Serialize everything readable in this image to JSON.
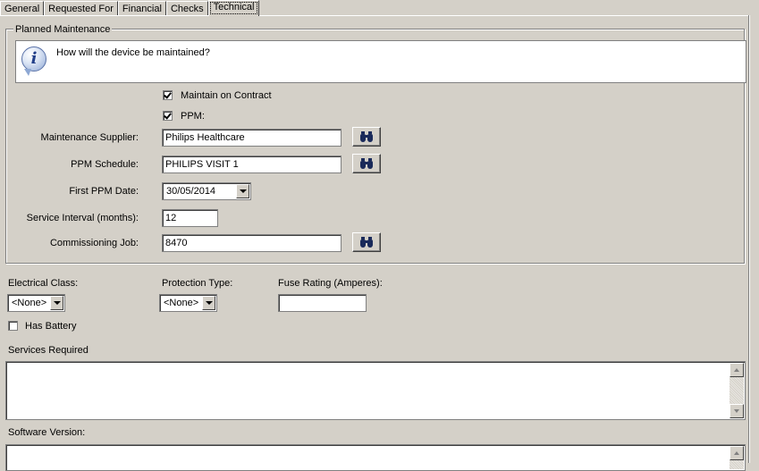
{
  "tabs": [
    {
      "label": "General"
    },
    {
      "label": "Requested For"
    },
    {
      "label": "Financial"
    },
    {
      "label": "Checks"
    },
    {
      "label": "Technical",
      "active": true
    }
  ],
  "planned_maintenance": {
    "title": "Planned Maintenance",
    "info_text": "How will the device be maintained?",
    "maintain_on_contract": {
      "label": "Maintain on Contract",
      "checked": true
    },
    "ppm": {
      "label": "PPM:",
      "checked": true
    },
    "maintenance_supplier": {
      "label": "Maintenance Supplier:",
      "value": "Philips Healthcare"
    },
    "ppm_schedule": {
      "label": "PPM Schedule:",
      "value": "PHILIPS VISIT 1"
    },
    "first_ppm_date": {
      "label": "First PPM Date:",
      "value": "30/05/2014"
    },
    "service_interval": {
      "label": "Service Interval (months):",
      "value": "12"
    },
    "commissioning_job": {
      "label": "Commissioning Job:",
      "value": "8470"
    }
  },
  "electrical": {
    "electrical_class": {
      "label": "Electrical Class:",
      "value": "<None>"
    },
    "protection_type": {
      "label": "Protection Type:",
      "value": "<None>"
    },
    "fuse_rating": {
      "label": "Fuse Rating (Amperes):",
      "value": ""
    },
    "has_battery": {
      "label": "Has Battery",
      "checked": false
    }
  },
  "services_required": {
    "label": "Services Required",
    "value": ""
  },
  "software_version": {
    "label": "Software Version:",
    "value": ""
  },
  "icons": {
    "info": "info-icon",
    "lookup": "binoculars-icon"
  }
}
